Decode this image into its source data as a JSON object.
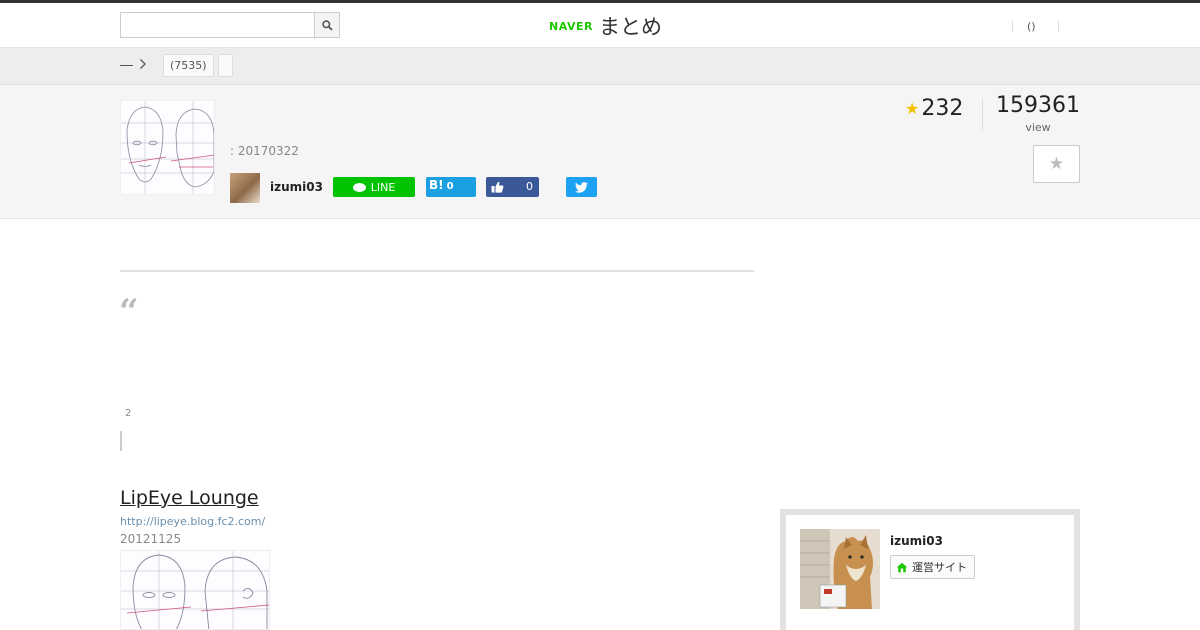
{
  "header": {
    "search": {
      "placeholder": "",
      "value": ""
    },
    "logo": {
      "naver": "NAVER",
      "matome": "まとめ"
    },
    "account_link": "()"
  },
  "breadcrumb": {
    "tag_label": "(7535)"
  },
  "summary": {
    "date": ": 20170322",
    "author": "izumi03",
    "share": {
      "line_label": "LINE",
      "hatena_label": "B!",
      "hatena_count": "0",
      "fb_count": "0"
    },
    "favorites": "232",
    "views": "159361",
    "views_label": "view"
  },
  "content": {
    "quote_mark": "“",
    "page_num": "2",
    "link": {
      "title": "LipEye Lounge",
      "url": "http://lipeye.blog.fc2.com/",
      "date": "20121125"
    }
  },
  "sidebar": {
    "author_name": "izumi03",
    "site_button": "運営サイト"
  },
  "colors": {
    "line_green": "#00c300",
    "hatena_blue": "#1ba0e1",
    "facebook_blue": "#3b5998",
    "twitter_blue": "#1da1f2",
    "naver_green": "#1ec800",
    "star_yellow": "#f2c200"
  },
  "icons": {
    "search": "search-icon",
    "chevron": "chevron-right-icon",
    "star": "star-icon",
    "line": "line-icon",
    "thumbs_up": "thumbs-up-icon",
    "twitter": "twitter-icon",
    "house": "house-icon"
  }
}
